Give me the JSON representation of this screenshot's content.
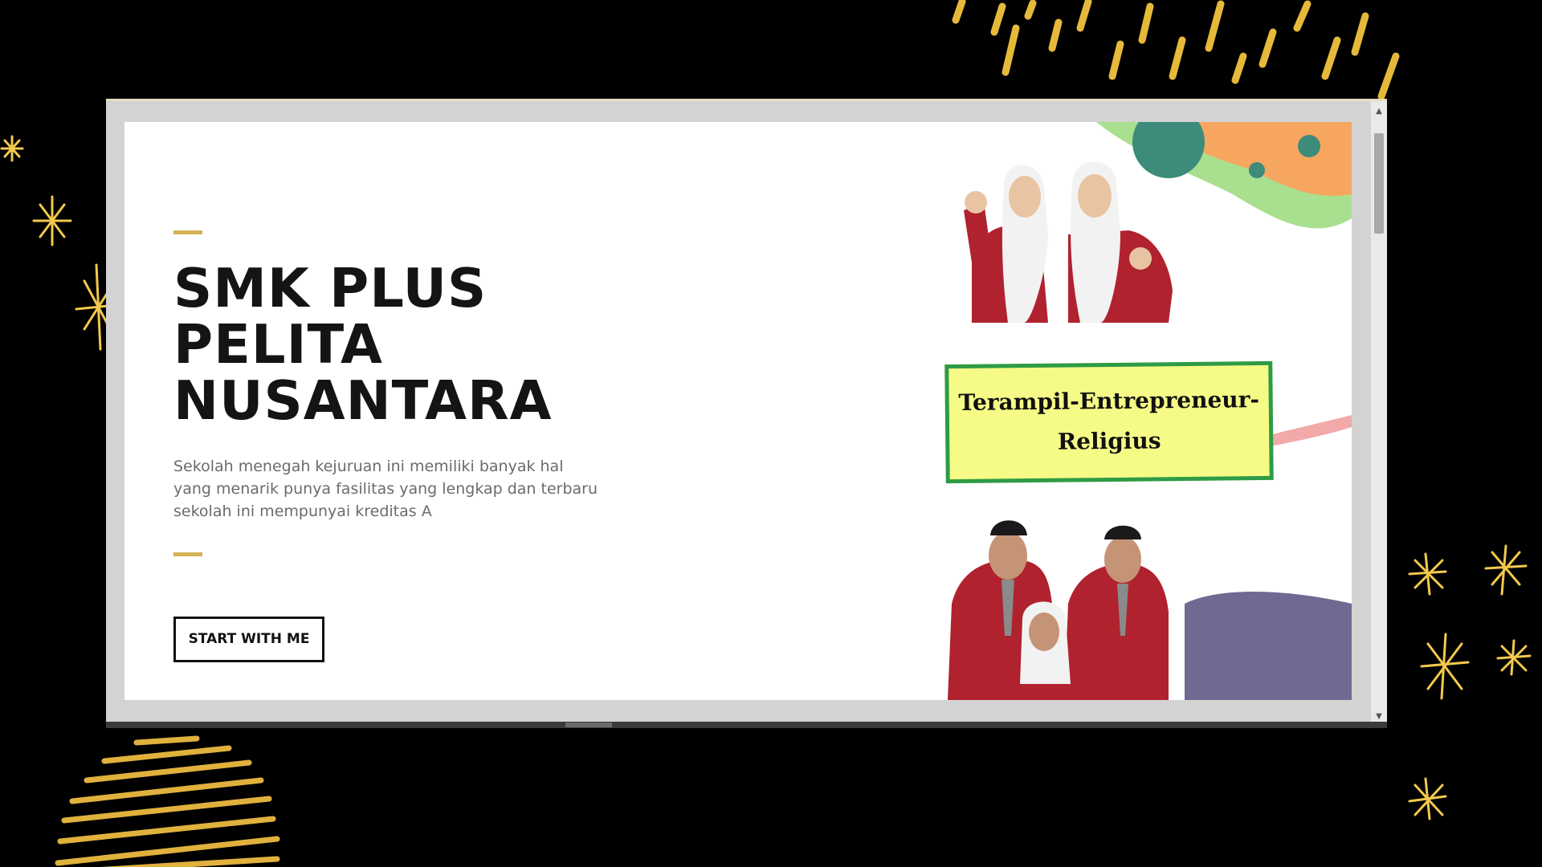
{
  "hero": {
    "title_lines": [
      "SMK PLUS",
      "PELITA",
      "NUSANTARA"
    ],
    "description_lines": [
      "Sekolah menegah kejuruan ini memiliki banyak hal",
      "yang menarik punya fasilitas yang lengkap dan terbaru",
      "sekolah ini mempunyai kreditas A"
    ],
    "cta_label": "START WITH ME"
  },
  "tagline": {
    "line1": "Terampil-Entrepreneur-",
    "line2": "Religius"
  },
  "scrollbar": {
    "up_icon": "triangle-up-icon",
    "down_icon": "triangle-down-icon"
  },
  "colors": {
    "accent": "#d4b256",
    "tagline_bg": "#f5fb86",
    "tagline_border": "#2e9b46",
    "uniform_red": "#b0222e",
    "page_background": "#000000"
  }
}
